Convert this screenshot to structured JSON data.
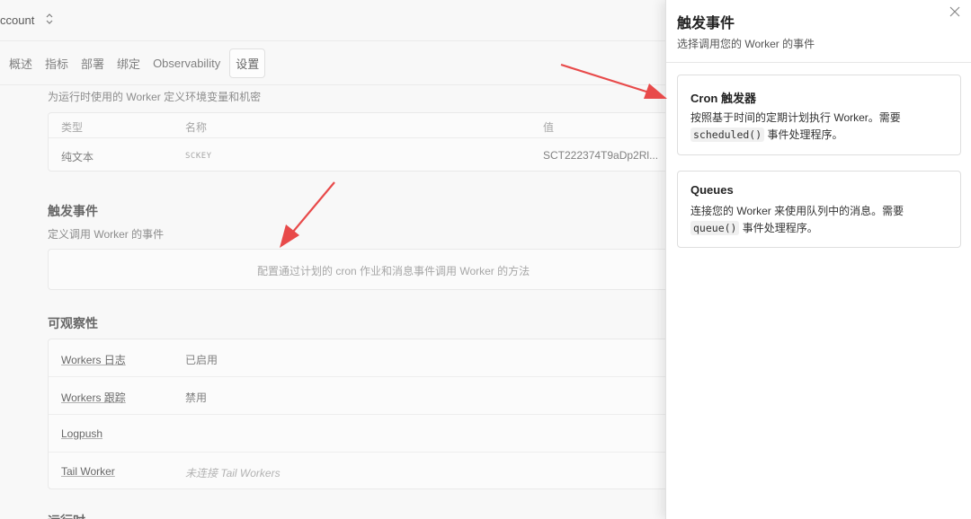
{
  "account": {
    "name": "ccount",
    "chevron": "⌃⌄"
  },
  "tabs": [
    {
      "label": "概述"
    },
    {
      "label": "指标"
    },
    {
      "label": "部署"
    },
    {
      "label": "绑定"
    },
    {
      "label": "Observability"
    },
    {
      "label": "设置"
    }
  ],
  "variables": {
    "description": "为运行时使用的 Worker 定义环境变量和机密",
    "headers": {
      "type": "类型",
      "name": "名称",
      "value": "值"
    },
    "rows": [
      {
        "type": "纯文本",
        "name": "SCKEY",
        "value": "SCT222374T9aDp2Rl..."
      }
    ]
  },
  "triggers": {
    "title": "触发事件",
    "description": "定义调用 Worker 的事件",
    "empty_text": "配置通过计划的 cron 作业和消息事件调用 Worker 的方法"
  },
  "observability": {
    "title": "可观察性",
    "rows": [
      {
        "label": "Workers 日志",
        "value": "已启用"
      },
      {
        "label": "Workers 跟踪",
        "value": "禁用"
      },
      {
        "label": "Logpush",
        "value": ""
      },
      {
        "label": "Tail Worker",
        "value": "未连接 Tail Workers"
      }
    ]
  },
  "runtime": {
    "title": "运行时"
  },
  "panel": {
    "title": "触发事件",
    "subtitle": "选择调用您的 Worker 的事件",
    "cards": [
      {
        "title": "Cron 触发器",
        "desc_line1": "按照基于时间的定期计划执行 Worker。需要",
        "code": "scheduled()",
        "desc_line2_suffix": " 事件处理程序。"
      },
      {
        "title": "Queues",
        "desc_line1": "连接您的 Worker 来使用队列中的消息。需要",
        "code": "queue()",
        "desc_line2_suffix": " 事件处理程序。"
      }
    ]
  },
  "colors": {
    "arrow": "#e84a4a",
    "panel_bg": "#ffffff",
    "page_bg": "#f6f6f6"
  },
  "icons": {
    "close": "close-icon",
    "chevron": "chevron-updown-icon"
  }
}
